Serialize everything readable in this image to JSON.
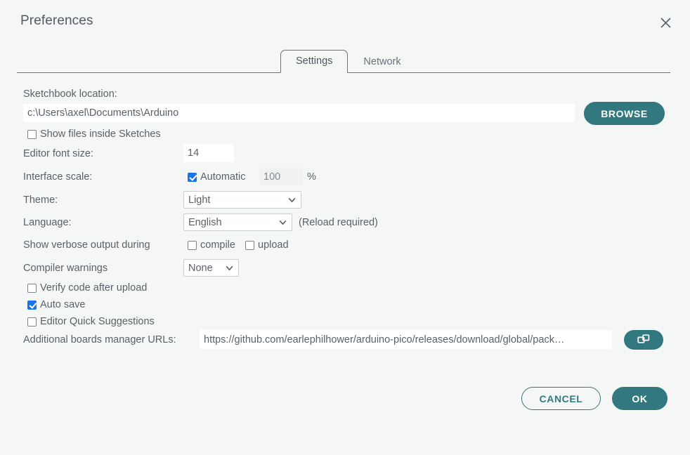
{
  "window": {
    "title": "Preferences",
    "close_icon": "close-icon"
  },
  "tabs": [
    {
      "label": "Settings",
      "active": true
    },
    {
      "label": "Network",
      "active": false
    }
  ],
  "settings": {
    "sketchbook": {
      "label": "Sketchbook location:",
      "value": "c:\\Users\\axel\\Documents\\Arduino",
      "browse_label": "BROWSE"
    },
    "show_files_inside_sketches": {
      "label": "Show files inside Sketches",
      "checked": false
    },
    "editor_font_size": {
      "label": "Editor font size:",
      "value": "14"
    },
    "interface_scale": {
      "label": "Interface scale:",
      "automatic_label": "Automatic",
      "automatic_checked": true,
      "value": "100",
      "unit": "%"
    },
    "theme": {
      "label": "Theme:",
      "value": "Light"
    },
    "language": {
      "label": "Language:",
      "value": "English",
      "note": "(Reload required)"
    },
    "verbose_output": {
      "label": "Show verbose output during",
      "compile_label": "compile",
      "compile_checked": false,
      "upload_label": "upload",
      "upload_checked": false
    },
    "compiler_warnings": {
      "label": "Compiler warnings",
      "value": "None"
    },
    "verify_code_after_upload": {
      "label": "Verify code after upload",
      "checked": false
    },
    "auto_save": {
      "label": "Auto save",
      "checked": true
    },
    "editor_quick_suggestions": {
      "label": "Editor Quick Suggestions",
      "checked": false
    },
    "boards_manager_urls": {
      "label": "Additional boards manager URLs:",
      "value": "https://github.com/earlephilhower/arduino-pico/releases/download/global/pack…",
      "expand_icon": "open-window-icon"
    }
  },
  "footer": {
    "cancel_label": "CANCEL",
    "ok_label": "OK"
  },
  "colors": {
    "accent_teal": "#32797f",
    "checkbox_blue": "#1a73e8",
    "background": "#f5f7f7",
    "text": "#5a6166"
  }
}
